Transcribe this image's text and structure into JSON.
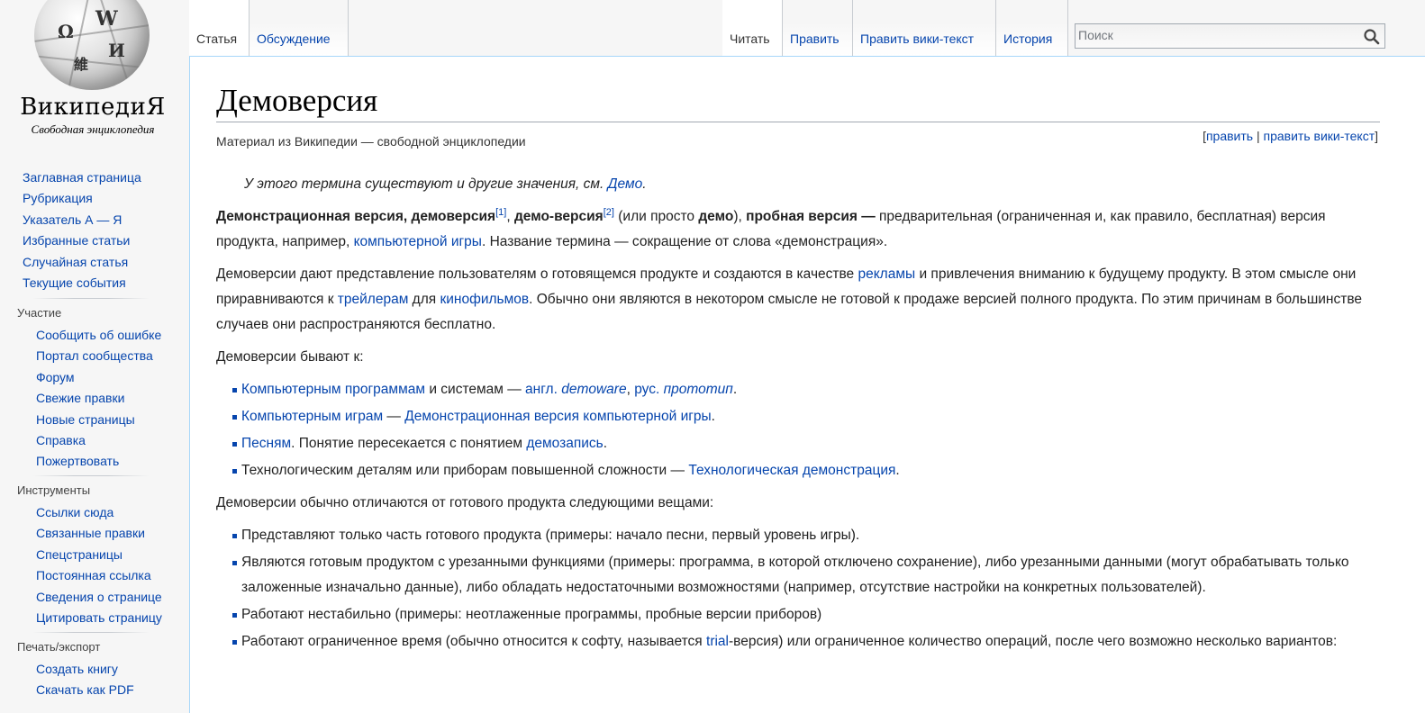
{
  "logo": {
    "globe_glyphs": [
      "Ω",
      "W",
      "И",
      "維"
    ],
    "wordmark": "ВикипедиЯ",
    "tagline": "Свободная энциклопедия"
  },
  "nav_main": [
    "Заглавная страница",
    "Рубрикация",
    "Указатель А — Я",
    "Избранные статьи",
    "Случайная статья",
    "Текущие события"
  ],
  "nav_participation": {
    "heading": "Участие",
    "items": [
      "Сообщить об ошибке",
      "Портал сообщества",
      "Форум",
      "Свежие правки",
      "Новые страницы",
      "Справка",
      "Пожертвовать"
    ]
  },
  "nav_tools": {
    "heading": "Инструменты",
    "items": [
      "Ссылки сюда",
      "Связанные правки",
      "Спецстраницы",
      "Постоянная ссылка",
      "Сведения о странице",
      "Цитировать страницу"
    ]
  },
  "nav_print": {
    "heading": "Печать/экспорт",
    "items": [
      "Создать книгу",
      "Скачать как PDF"
    ]
  },
  "tabs_left": [
    "Статья",
    "Обсуждение"
  ],
  "tabs_right": [
    "Читать",
    "Править",
    "Править вики-текст",
    "История"
  ],
  "search": {
    "placeholder": "Поиск",
    "icon": "magnifier-icon"
  },
  "article": {
    "title": "Демоверсия",
    "site_sub": "Материал из Википедии — свободной энциклопедии",
    "edit_links": {
      "open": "[",
      "edit": "править",
      "sep": " | ",
      "edit_source": "править вики-текст",
      "close": "]"
    },
    "hatnote": {
      "text": "У этого термина существуют и другие значения, см. ",
      "link": "Демо",
      "end": "."
    },
    "p1": {
      "b1": "Демонстрационная версия, демоверсия",
      "ref1": "[1]",
      "comma": ", ",
      "b2": "демо-версия",
      "ref2": "[2]",
      "t1": " (или просто ",
      "b3": "демо",
      "t2": "), ",
      "b4": "пробная версия —",
      "t3": " предварительная (ограниченная и, как правило, бесплатная) версия продукта, например, ",
      "link1": "компьютерной игры",
      "t4": ". Название термина — сокращение от слова «демонстрация»."
    },
    "p2": {
      "t1": "Демоверсии дают представление пользователям о готовящемся продукте и создаются в качестве ",
      "link1": "рекламы",
      "t2": " и привлечения вниманию к будущему продукту. В этом смысле они приравниваются к ",
      "link2": "трейлерам",
      "t3": " для ",
      "link3": "кинофильмов",
      "t4": ". Обычно они являются в некотором смысле не готовой к продаже версией полного продукта. По этим причинам в большинстве случаев они распространяются бесплатно."
    },
    "p3": "Демоверсии бывают к:",
    "list1": {
      "i1": {
        "link1": "Компьютерным программам",
        "t1": " и системам — ",
        "link2": "англ.",
        "t2": " ",
        "em1": "demoware",
        "t3": ", ",
        "link3": "рус.",
        "t4": " ",
        "em2": "прототип",
        "t5": "."
      },
      "i2": {
        "link1": "Компьютерным играм",
        "t1": " — ",
        "link2": "Демонстрационная версия компьютерной игры",
        "t2": "."
      },
      "i3": {
        "link1": "Песням",
        "t1": ". Понятие пересекается с понятием ",
        "link2": "демозапись",
        "t2": "."
      },
      "i4": {
        "t1": "Технологическим деталям или приборам повышенной сложности — ",
        "link1": "Технологическая демонстрация",
        "t2": "."
      }
    },
    "p4": "Демоверсии обычно отличаются от готового продукта следующими вещами:",
    "list2": {
      "i1": "Представляют только часть готового продукта (примеры: начало песни, первый уровень игры).",
      "i2": "Являются готовым продуктом с урезанными функциями (примеры: программа, в которой отключено сохранение), либо урезанными данными (могут обрабатывать только заложенные изначально данные), либо обладать недостаточными возможностями (например, отсутствие настройки на конкретных пользователей).",
      "i3": "Работают нестабильно (примеры: неотлаженные программы, пробные версии приборов)",
      "i4": {
        "t1": "Работают ограниченное время (обычно относится к софту, называется ",
        "link1": "trial",
        "t2": "-версия) или ограниченное количество операций, после чего возможно несколько вариантов:"
      }
    }
  }
}
